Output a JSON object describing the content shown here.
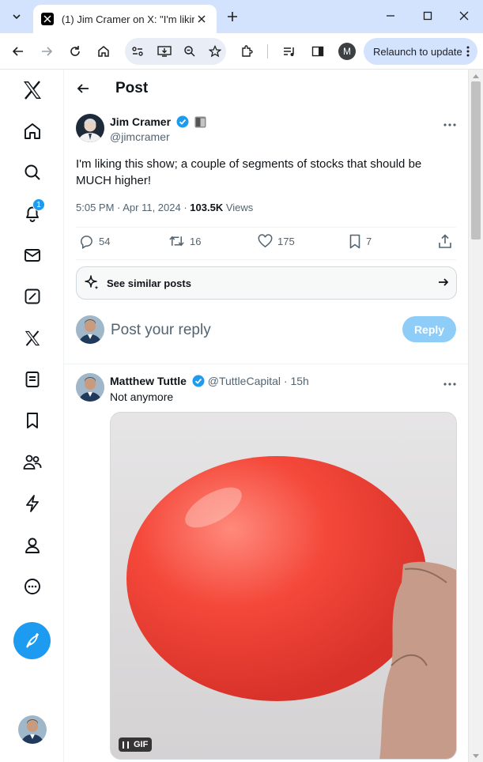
{
  "browser": {
    "tab_title": "(1) Jim Cramer on X: \"I'm liking",
    "relaunch_label": "Relaunch to update",
    "profile_initial": "M"
  },
  "nav": {
    "notifications_badge": "1",
    "items": [
      "x-logo-icon",
      "home-icon",
      "search-icon",
      "notifications-icon",
      "messages-icon",
      "grok-icon",
      "premium-x-icon",
      "lists-icon",
      "bookmarks-icon",
      "communities-icon",
      "verified-orgs-icon",
      "profile-icon",
      "more-icon"
    ]
  },
  "header": {
    "title": "Post"
  },
  "post": {
    "author_name": "Jim Cramer",
    "author_handle": "@jimcramer",
    "text": "I'm liking this show; a couple of segments of stocks that should be MUCH higher!",
    "time": "5:05 PM · Apr 11, 2024 · ",
    "views_count": "103.5K",
    "views_label": " Views",
    "replies": "54",
    "reposts": "16",
    "likes": "175",
    "bookmarks": "7"
  },
  "similar": {
    "label": "See similar posts"
  },
  "reply_box": {
    "placeholder": "Post your reply",
    "button": "Reply"
  },
  "reply": {
    "author_name": "Matthew Tuttle",
    "handle_time": "@TuttleCapital · 15h",
    "text": "Not anymore",
    "gif_label": "GIF"
  },
  "colors": {
    "accent": "#1d9bf0",
    "balloon": "#f4483a"
  }
}
